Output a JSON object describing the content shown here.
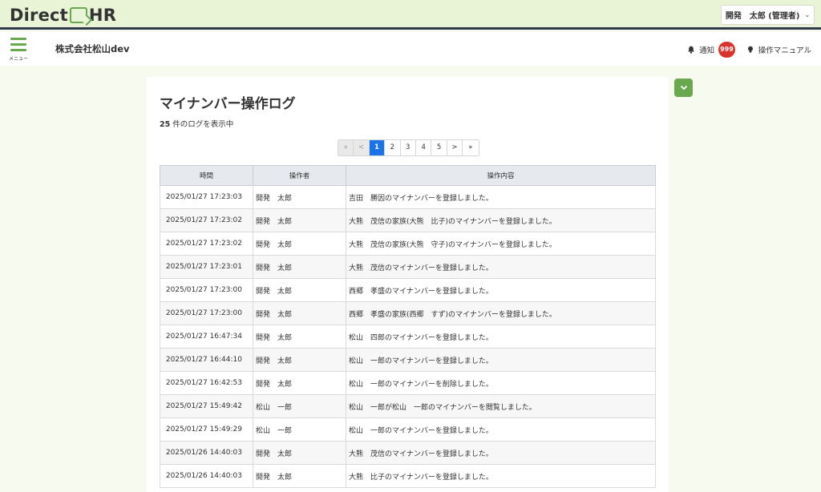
{
  "brand": {
    "left": "Direct",
    "right": "HR"
  },
  "user_menu": {
    "label": "開発　太郎 (管理者)"
  },
  "header": {
    "menu_label": "メニュー",
    "company": "株式会社松山dev",
    "notice_label": "通知",
    "notice_count": "999",
    "manual_label": "操作マニュアル"
  },
  "page": {
    "title": "マイナンバー操作ログ",
    "count": "25",
    "count_suffix": " 件のログを表示中"
  },
  "pagination": {
    "first": "«",
    "prev": "<",
    "pages": [
      "1",
      "2",
      "3",
      "4",
      "5"
    ],
    "current": "1",
    "next": ">",
    "last": "»"
  },
  "table": {
    "headers": [
      "時間",
      "操作者",
      "操作内容"
    ],
    "rows": [
      [
        "2025/01/27 17:23:03",
        "開発　太郎",
        "吉田　勝因のマイナンバーを登録しました。"
      ],
      [
        "2025/01/27 17:23:02",
        "開発　太郎",
        "大熊　茂信の家族(大熊　比子)のマイナンバーを登録しました。"
      ],
      [
        "2025/01/27 17:23:02",
        "開発　太郎",
        "大熊　茂信の家族(大熊　守子)のマイナンバーを登録しました。"
      ],
      [
        "2025/01/27 17:23:01",
        "開発　太郎",
        "大熊　茂信のマイナンバーを登録しました。"
      ],
      [
        "2025/01/27 17:23:00",
        "開発　太郎",
        "西郷　孝盛のマイナンバーを登録しました。"
      ],
      [
        "2025/01/27 17:23:00",
        "開発　太郎",
        "西郷　孝盛の家族(西郷　すず)のマイナンバーを登録しました。"
      ],
      [
        "2025/01/27 16:47:34",
        "開発　太郎",
        "松山　四郎のマイナンバーを登録しました。"
      ],
      [
        "2025/01/27 16:44:10",
        "開発　太郎",
        "松山　一郎のマイナンバーを登録しました。"
      ],
      [
        "2025/01/27 16:42:53",
        "開発　太郎",
        "松山　一郎のマイナンバーを削除しました。"
      ],
      [
        "2025/01/27 15:49:42",
        "松山　一郎",
        "松山　一郎が松山　一郎のマイナンバーを閲覧しました。"
      ],
      [
        "2025/01/27 15:49:29",
        "松山　一郎",
        "松山　一郎のマイナンバーを登録しました。"
      ],
      [
        "2025/01/26 14:40:03",
        "開発　太郎",
        "大熊　茂信のマイナンバーを登録しました。"
      ],
      [
        "2025/01/26 14:40:03",
        "開発　太郎",
        "大熊　比子のマイナンバーを登録しました。"
      ]
    ]
  },
  "colors": {
    "accent": "#6aa84f",
    "page_active": "#1a73e8",
    "badge": "#d9342b"
  }
}
